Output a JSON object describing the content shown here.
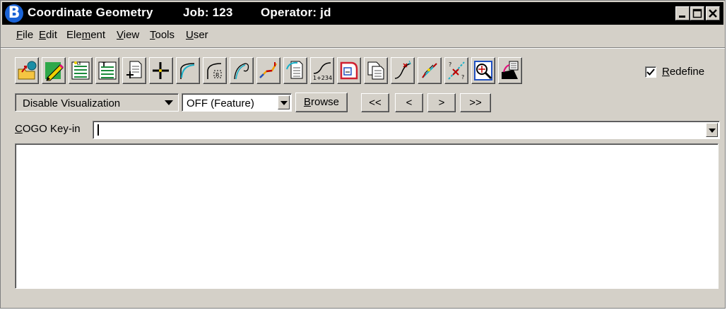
{
  "titlebar": {
    "app": "Coordinate Geometry",
    "job": "Job: 123",
    "operator": "Operator: jd",
    "icon_letter": "B",
    "icon_color": "#1a63d6"
  },
  "menu": {
    "file": {
      "u": "F",
      "rest": "ile"
    },
    "edit": {
      "u": "E",
      "rest": "dit"
    },
    "element": {
      "pre": "Ele",
      "u": "m",
      "rest": "ent"
    },
    "view": {
      "u": "V",
      "rest": "iew"
    },
    "tools": {
      "u": "T",
      "rest": "ools"
    },
    "user": {
      "u": "U",
      "rest": "ser"
    }
  },
  "toolbar": {
    "tools": [
      "store-point-icon",
      "edit-pencil-icon",
      "element-list-icon",
      "text-list-icon",
      "add-page-icon",
      "point-cross-icon",
      "curve-icon",
      "radius-curve-icon",
      "spiral-icon",
      "chain-line-icon",
      "document-curve-icon",
      "stationing-icon",
      "parcel-icon",
      "copy-pages-icon",
      "profile-curve-icon",
      "inverse-icon",
      "intersect-icon",
      "zoom-target-icon",
      "visualize-icon"
    ],
    "redefine_checked": true,
    "redefine": {
      "u": "R",
      "rest": "edefine"
    }
  },
  "controls": {
    "visualization": "Disable Visualization",
    "feature": "OFF (Feature)",
    "browse": {
      "u": "B",
      "rest": "rowse"
    },
    "nav_first": "<<",
    "nav_prev": "<",
    "nav_next": ">",
    "nav_last": ">>"
  },
  "keyin": {
    "label_u": "C",
    "label_rest": "OGO Key-in",
    "value": ""
  },
  "output": {
    "text": ""
  }
}
